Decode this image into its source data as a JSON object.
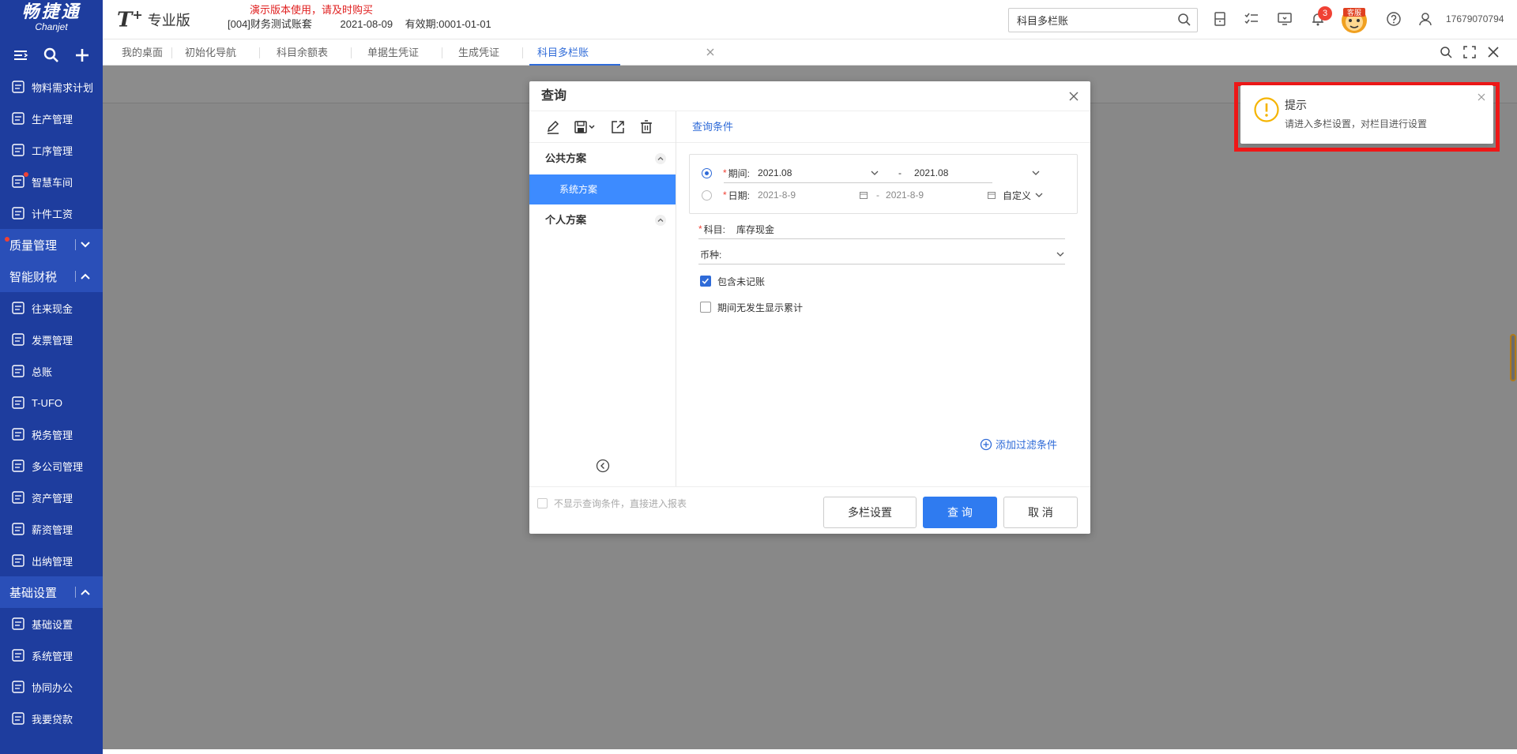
{
  "header": {
    "logo_cn": "畅捷通",
    "logo_en": "Chanjet",
    "brand": "T+",
    "brand_sup": "+",
    "edition": "专业版",
    "demo_notice": "演示版本使用，请及时购买",
    "account": "[004]财务测试账套",
    "date": "2021-08-09",
    "expiry": "有效期:0001-01-01",
    "search_value": "科目多栏账",
    "notification_count": "3",
    "kefu_label": "客服",
    "user_id": "17679070794"
  },
  "sidebar": {
    "items_top": [
      {
        "label": "物料需求计划",
        "icon": "cube-icon"
      },
      {
        "label": "生产管理",
        "icon": "list-icon"
      },
      {
        "label": "工序管理",
        "icon": "process-icon"
      },
      {
        "label": "智慧车间",
        "icon": "workshop-icon",
        "dot": true
      },
      {
        "label": "计件工资",
        "icon": "wage-icon"
      }
    ],
    "group_quality": "质量管理",
    "group_finance": "智能财税",
    "items_finance": [
      {
        "label": "往来现金",
        "icon": "exchange-icon"
      },
      {
        "label": "发票管理",
        "icon": "invoice-icon"
      },
      {
        "label": "总账",
        "icon": "ledger-icon"
      },
      {
        "label": "T-UFO",
        "icon": "report-icon"
      },
      {
        "label": "税务管理",
        "icon": "tax-icon"
      },
      {
        "label": "多公司管理",
        "icon": "building-icon"
      },
      {
        "label": "资产管理",
        "icon": "bank-icon"
      },
      {
        "label": "薪资管理",
        "icon": "salary-icon"
      },
      {
        "label": "出纳管理",
        "icon": "cashier-icon"
      }
    ],
    "group_basic": "基础设置",
    "items_basic": [
      {
        "label": "基础设置",
        "icon": "settings-icon"
      },
      {
        "label": "系统管理",
        "icon": "system-icon"
      },
      {
        "label": "协同办公",
        "icon": "collab-icon"
      },
      {
        "label": "我要贷款",
        "icon": "loan-icon"
      }
    ]
  },
  "tabs": [
    {
      "label": "我的桌面"
    },
    {
      "label": "初始化导航"
    },
    {
      "label": "科目余额表"
    },
    {
      "label": "单据生凭证"
    },
    {
      "label": "生成凭证"
    },
    {
      "label": "科目多栏账",
      "active": true
    }
  ],
  "dialog": {
    "title": "查询",
    "public_scheme": "公共方案",
    "system_scheme": "系统方案",
    "personal_scheme": "个人方案",
    "condition_tab": "查询条件",
    "period_label": "期间:",
    "period_from": "2021.08",
    "period_dash": "-",
    "period_to": "2021.08",
    "date_label": "日期:",
    "date_from": "2021-8-9",
    "date_dash": "-",
    "date_to": "2021-8-9",
    "date_mode": "自定义",
    "subject_label": "科目:",
    "subject_value": "库存现金",
    "currency_label": "币种:",
    "include_unposted": "包含未记账",
    "show_cumulative": "期间无发生显示累计",
    "add_filter": "添加过滤条件",
    "skip_query": "不显示查询条件，直接进入报表",
    "btn_multicol": "多栏设置",
    "btn_query": "查 询",
    "btn_cancel": "取 消"
  },
  "notification": {
    "title": "提示",
    "message": "请进入多栏设置，对栏目进行设置"
  }
}
